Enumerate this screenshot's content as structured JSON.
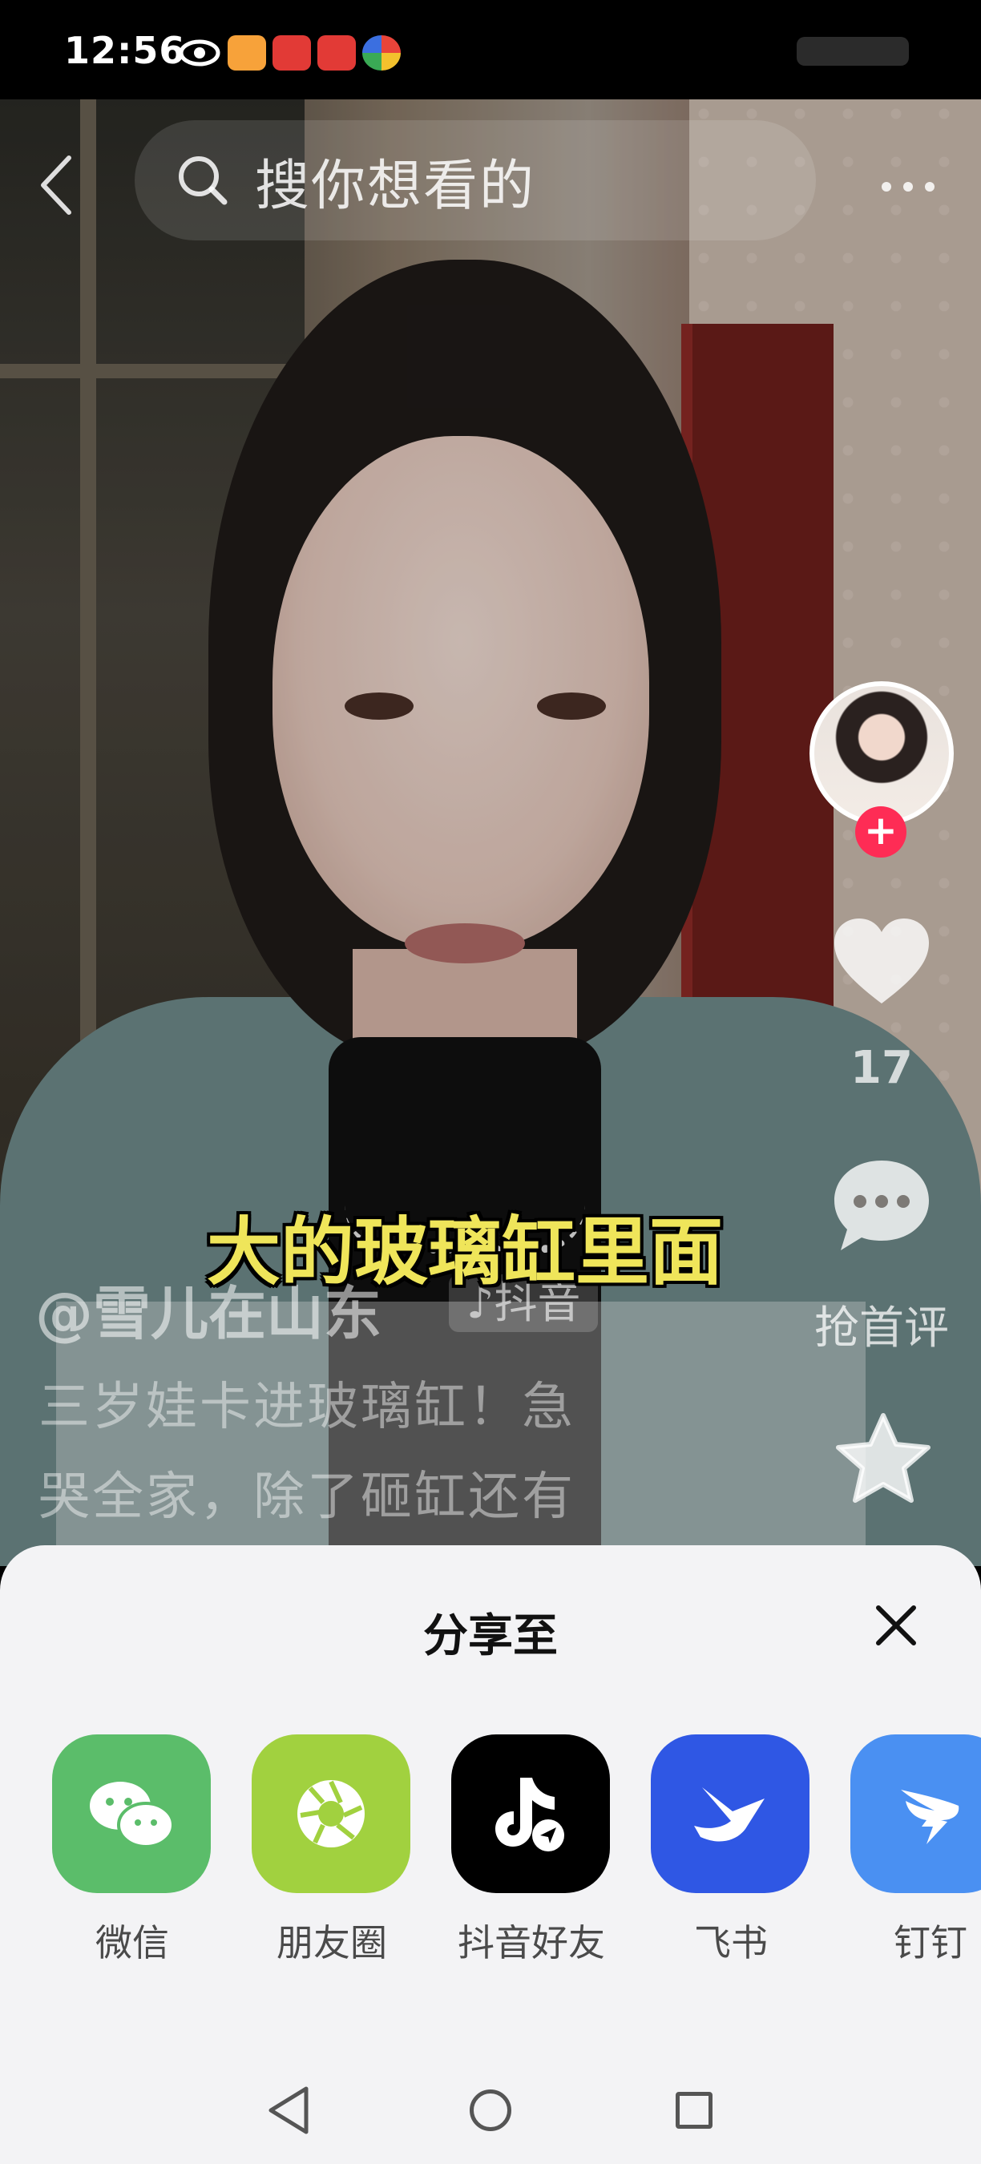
{
  "status_bar": {
    "time": "12:56"
  },
  "search": {
    "placeholder": "搜你想看的"
  },
  "video": {
    "caption": "大的玻璃缸里面",
    "author": "@雪儿在山东",
    "platform_badge": "♪抖音",
    "description_line1": "三岁娃卡进玻璃缸！急",
    "description_line2": "哭全家，除了砸缸还有"
  },
  "actions": {
    "like_count": "17",
    "comment_label": "抢首评",
    "follow_symbol": "+"
  },
  "share_sheet": {
    "title": "分享至",
    "items": [
      {
        "label": "微信",
        "icon": "wechat-icon",
        "color": "#5bbd6a"
      },
      {
        "label": "朋友圈",
        "icon": "moments-icon",
        "color": "#a1d13f"
      },
      {
        "label": "抖音好友",
        "icon": "douyin-icon",
        "color": "#000000"
      },
      {
        "label": "飞书",
        "icon": "feishu-icon",
        "color": "#2f57e4"
      },
      {
        "label": "钉钉",
        "icon": "dingtalk-icon",
        "color": "#4a90f2"
      }
    ]
  },
  "colors": {
    "follow_red": "#fe2c55",
    "caption_yellow": "#efe55a",
    "sheet_bg": "#f3f3f5"
  }
}
